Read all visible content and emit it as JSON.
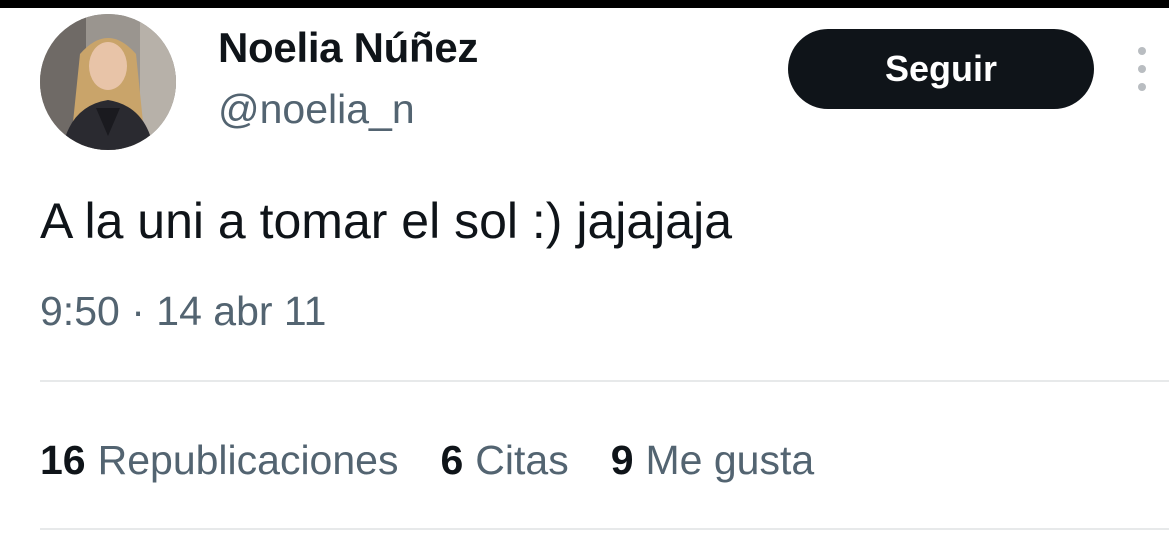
{
  "author": {
    "name": "Noelia Núñez",
    "handle": "@noelia_n"
  },
  "follow_button": {
    "label": "Seguir"
  },
  "more_icon": "more-vertical-icon",
  "tweet": {
    "text": "A la uni a tomar el sol :) jajajaja",
    "time": "9:50",
    "separator": "·",
    "date": "14 abr 11"
  },
  "stats": [
    {
      "count": "16",
      "label": "Republicaciones"
    },
    {
      "count": "6",
      "label": "Citas"
    },
    {
      "count": "9",
      "label": "Me gusta"
    }
  ],
  "colors": {
    "text_primary": "#0f1419",
    "text_secondary": "#536471",
    "button_background": "#0f1419",
    "divider": "#e7e9ea"
  }
}
